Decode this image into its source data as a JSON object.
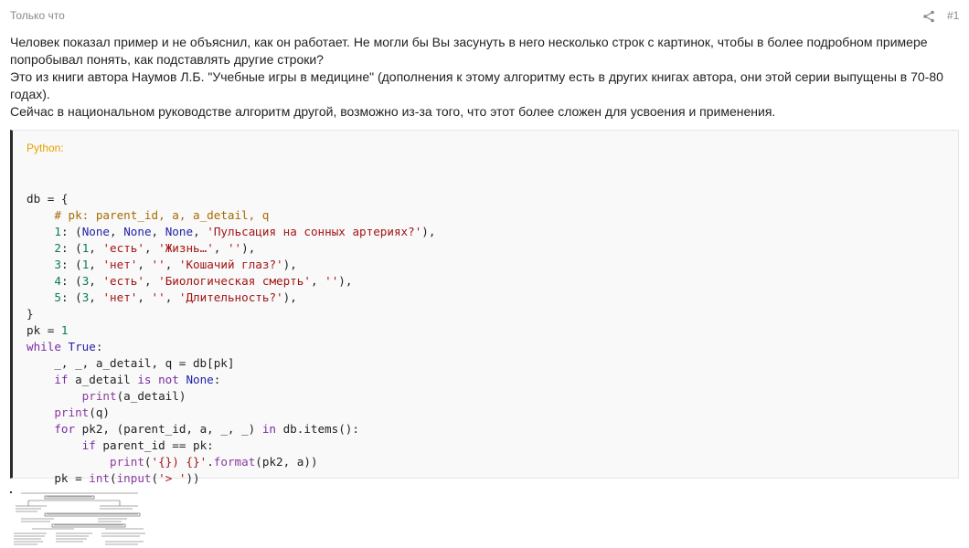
{
  "post": {
    "time": "Только что",
    "number": "#1",
    "share_icon": "share-icon",
    "paragraphs": [
      "Человек показал пример и не объяснил, как он работает. Не могли бы Вы засунуть в него несколько строк с картинок, чтобы в более подробном примере попробывал понять, как подставлять другие строки?",
      "Это из книги автора Наумов Л.Б. \"Учебные игры в медицине\" (дополнения к этому алгоритму есть в других книгах автора, они этой серии выпущены в 70-80 годах).",
      "Сейчас в национальном руководстве алгоритм другой, возможно из-за того, что этот более сложен для усвоения и применения."
    ]
  },
  "code": {
    "language": "Python:",
    "lines": [
      [],
      [
        [
          "plain",
          "db = {"
        ]
      ],
      [
        [
          "plain",
          "    "
        ],
        [
          "com",
          "# pk: parent_id, a, a_detail, q"
        ]
      ],
      [
        [
          "plain",
          "    "
        ],
        [
          "num",
          "1"
        ],
        [
          "plain",
          ": ("
        ],
        [
          "const",
          "None"
        ],
        [
          "plain",
          ", "
        ],
        [
          "const",
          "None"
        ],
        [
          "plain",
          ", "
        ],
        [
          "const",
          "None"
        ],
        [
          "plain",
          ", "
        ],
        [
          "str",
          "'Пульсация на сонных артериях?'"
        ],
        [
          "plain",
          "),"
        ]
      ],
      [
        [
          "plain",
          "    "
        ],
        [
          "num",
          "2"
        ],
        [
          "plain",
          ": ("
        ],
        [
          "num",
          "1"
        ],
        [
          "plain",
          ", "
        ],
        [
          "str",
          "'есть'"
        ],
        [
          "plain",
          ", "
        ],
        [
          "str",
          "'Жизнь…'"
        ],
        [
          "plain",
          ", "
        ],
        [
          "str",
          "''"
        ],
        [
          "plain",
          "),"
        ]
      ],
      [
        [
          "plain",
          "    "
        ],
        [
          "num",
          "3"
        ],
        [
          "plain",
          ": ("
        ],
        [
          "num",
          "1"
        ],
        [
          "plain",
          ", "
        ],
        [
          "str",
          "'нет'"
        ],
        [
          "plain",
          ", "
        ],
        [
          "str",
          "''"
        ],
        [
          "plain",
          ", "
        ],
        [
          "str",
          "'Кошачий глаз?'"
        ],
        [
          "plain",
          "),"
        ]
      ],
      [
        [
          "plain",
          "    "
        ],
        [
          "num",
          "4"
        ],
        [
          "plain",
          ": ("
        ],
        [
          "num",
          "3"
        ],
        [
          "plain",
          ", "
        ],
        [
          "str",
          "'есть'"
        ],
        [
          "plain",
          ", "
        ],
        [
          "str",
          "'Биологическая смерть'"
        ],
        [
          "plain",
          ", "
        ],
        [
          "str",
          "''"
        ],
        [
          "plain",
          "),"
        ]
      ],
      [
        [
          "plain",
          "    "
        ],
        [
          "num",
          "5"
        ],
        [
          "plain",
          ": ("
        ],
        [
          "num",
          "3"
        ],
        [
          "plain",
          ", "
        ],
        [
          "str",
          "'нет'"
        ],
        [
          "plain",
          ", "
        ],
        [
          "str",
          "''"
        ],
        [
          "plain",
          ", "
        ],
        [
          "str",
          "'Длительность?'"
        ],
        [
          "plain",
          "),"
        ]
      ],
      [
        [
          "plain",
          "}"
        ]
      ],
      [
        [
          "plain",
          "pk = "
        ],
        [
          "num",
          "1"
        ]
      ],
      [
        [
          "kw",
          "while"
        ],
        [
          "plain",
          " "
        ],
        [
          "const",
          "True"
        ],
        [
          "plain",
          ":"
        ]
      ],
      [
        [
          "plain",
          "    _, _, a_detail, q = db[pk]"
        ]
      ],
      [
        [
          "plain",
          "    "
        ],
        [
          "kw",
          "if"
        ],
        [
          "plain",
          " a_detail "
        ],
        [
          "kw",
          "is not"
        ],
        [
          "plain",
          " "
        ],
        [
          "const",
          "None"
        ],
        [
          "plain",
          ":"
        ]
      ],
      [
        [
          "plain",
          "        "
        ],
        [
          "fn",
          "print"
        ],
        [
          "plain",
          "(a_detail)"
        ]
      ],
      [
        [
          "plain",
          "    "
        ],
        [
          "fn",
          "print"
        ],
        [
          "plain",
          "(q)"
        ]
      ],
      [
        [
          "plain",
          "    "
        ],
        [
          "kw",
          "for"
        ],
        [
          "plain",
          " pk2, (parent_id, a, _, _) "
        ],
        [
          "kw",
          "in"
        ],
        [
          "plain",
          " db.items():"
        ]
      ],
      [
        [
          "plain",
          "        "
        ],
        [
          "kw",
          "if"
        ],
        [
          "plain",
          " parent_id == pk:"
        ]
      ],
      [
        [
          "plain",
          "            "
        ],
        [
          "fn",
          "print"
        ],
        [
          "plain",
          "("
        ],
        [
          "str",
          "'{}) {}'"
        ],
        [
          "plain",
          "."
        ],
        [
          "fn",
          "format"
        ],
        [
          "plain",
          "(pk2, a))"
        ]
      ],
      [
        [
          "plain",
          "    pk = "
        ],
        [
          "fn",
          "int"
        ],
        [
          "plain",
          "("
        ],
        [
          "fn",
          "input"
        ],
        [
          "plain",
          "("
        ],
        [
          "str",
          "'> '"
        ],
        [
          "plain",
          "))"
        ]
      ]
    ]
  },
  "attachment": {
    "kind": "scanned-algorithm-diagram"
  }
}
